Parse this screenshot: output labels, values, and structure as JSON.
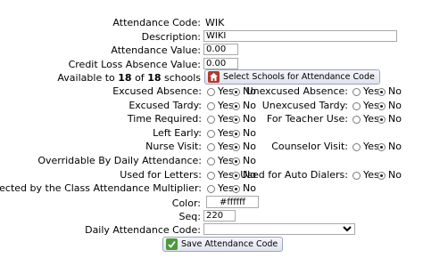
{
  "form": {
    "attendance_code": {
      "label": "Attendance Code:",
      "value": "WIK"
    },
    "description": {
      "label": "Description:",
      "value": "WIKI"
    },
    "attendance_value": {
      "label": "Attendance Value:",
      "value": "0.00"
    },
    "credit_loss": {
      "label": "Credit Loss Absence Value:",
      "value": "0.00"
    },
    "available": {
      "prefix": "Available to",
      "count": "18",
      "of": "of",
      "total": "18",
      "suffix": "schools"
    },
    "select_schools_button": "Select Schools for Attendance Code",
    "yes_label": "Yes",
    "no_label": "No",
    "left_fields": [
      {
        "label": "Excused Absence:",
        "selected": "no"
      },
      {
        "label": "Excused Tardy:",
        "selected": "no"
      },
      {
        "label": "Time Required:",
        "selected": "no"
      },
      {
        "label": "Left Early:",
        "selected": "no"
      },
      {
        "label": "Nurse Visit:",
        "selected": "no"
      },
      {
        "label": "Overridable By Daily Attendance:",
        "selected": "no"
      },
      {
        "label": "Used for Letters:",
        "selected": "no"
      },
      {
        "label": "Affected by the Class Attendance Multiplier:",
        "selected": "no"
      }
    ],
    "right_fields": [
      {
        "label": "Unexcused Absence:",
        "selected": "no"
      },
      {
        "label": "Unexcused Tardy:",
        "selected": "no"
      },
      {
        "label": "For Teacher Use:",
        "selected": "no"
      },
      {
        "label": "Counselor Visit:",
        "selected": "no"
      },
      {
        "label": "Used for Auto Dialers:",
        "selected": "no"
      }
    ],
    "color": {
      "label": "Color:",
      "value": "#ffffff"
    },
    "seq": {
      "label": "Seq:",
      "value": "220"
    },
    "daily_code": {
      "label": "Daily Attendance Code:",
      "value": ""
    },
    "save_button": "Save Attendance Code"
  }
}
